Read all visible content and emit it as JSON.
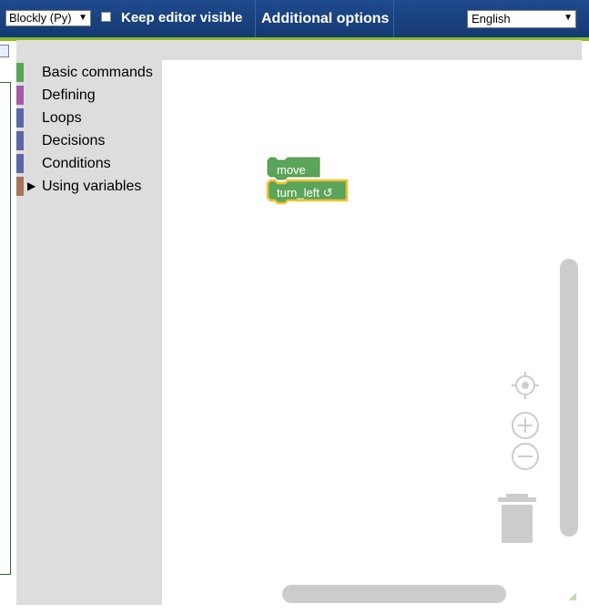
{
  "header": {
    "mode_select": "Blockly (Py)",
    "keep_editor_visible": "Keep editor visible",
    "keep_editor_checked": false,
    "additional_options": "Additional options",
    "language_select": "English",
    "accent_color": "#8dbb2b",
    "bar_color": "#1f4a8c"
  },
  "toolbox": {
    "categories": [
      {
        "label": "Basic commands",
        "color": "#5ba55b"
      },
      {
        "label": "Defining",
        "color": "#a55ba5"
      },
      {
        "label": "Loops",
        "color": "#5b67a5"
      },
      {
        "label": "Decisions",
        "color": "#5b67a5"
      },
      {
        "label": "Conditions",
        "color": "#5b67a5"
      },
      {
        "label": "Using variables",
        "color": "#a5745b",
        "expandable": true
      }
    ]
  },
  "workspace": {
    "blocks": [
      {
        "label": "move",
        "color": "#5ba55b"
      },
      {
        "label": "turn_left ↺",
        "color": "#5ba55b",
        "selected": true,
        "highlight": "#f2c230"
      }
    ]
  },
  "icons": {
    "recenter": "crosshair-icon",
    "zoom_in": "zoom-in-icon",
    "zoom_out": "zoom-out-icon",
    "trash": "trash-icon"
  }
}
